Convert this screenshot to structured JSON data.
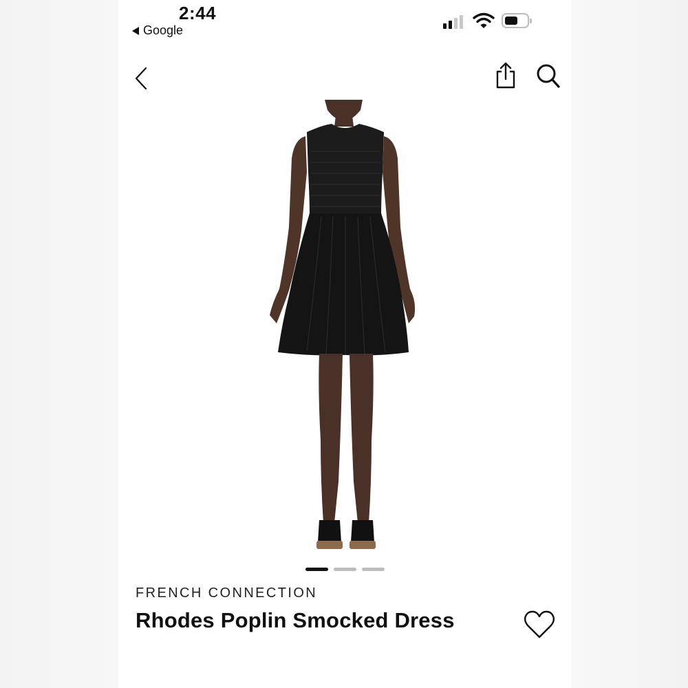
{
  "status_bar": {
    "time": "2:44",
    "back_app": "Google",
    "icons": [
      "cellular-signal-icon",
      "wifi-icon",
      "battery-icon"
    ]
  },
  "nav": {
    "icons": [
      "chevron-left-icon",
      "share-icon",
      "search-icon"
    ]
  },
  "product": {
    "image": "model-wearing-black-dress-image",
    "brand": "FRENCH CONNECTION",
    "name": "Rhodes Poplin Smocked Dress",
    "carousel": {
      "count": 3,
      "active_index": 0
    },
    "favorite_icon": "heart-outline-icon"
  },
  "colors": {
    "text": "#111111",
    "dot_active": "#111111",
    "dot_inactive": "#bdbdbd",
    "background": "#ffffff"
  }
}
